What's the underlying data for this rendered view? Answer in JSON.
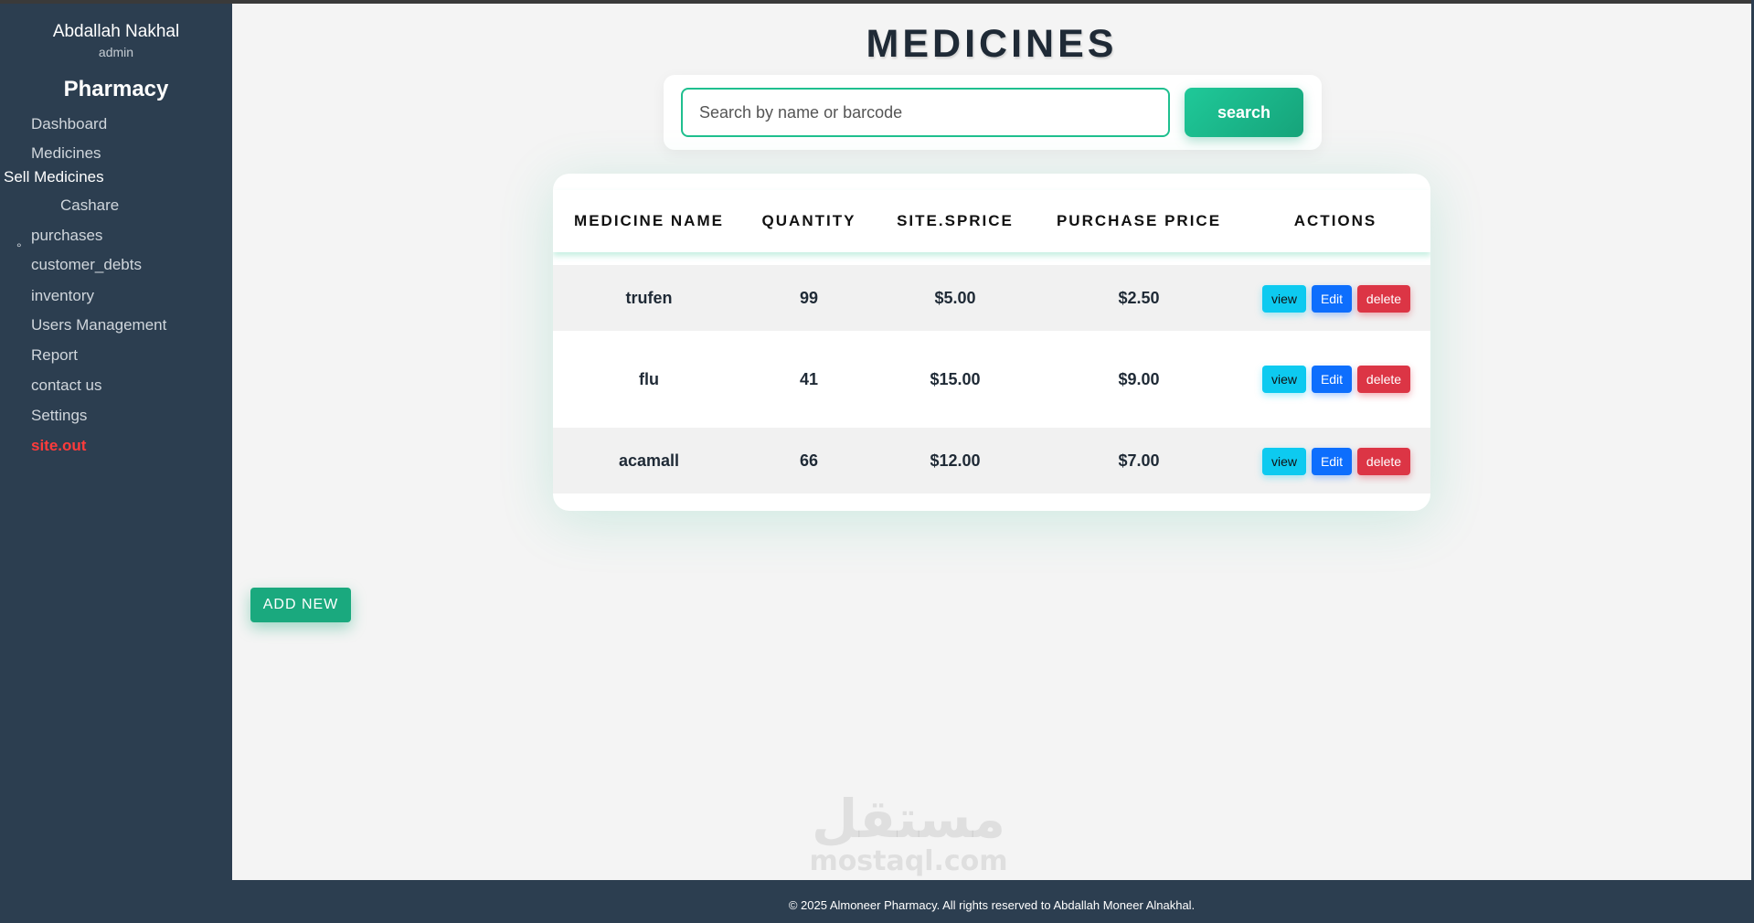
{
  "sidebar": {
    "user_name": "Abdallah Nakhal",
    "user_role": "admin",
    "brand": "Pharmacy",
    "items": [
      {
        "label": "Dashboard"
      },
      {
        "label": "Medicines"
      },
      {
        "label": "Sell Medicines"
      },
      {
        "label": "Cashare"
      },
      {
        "label": "purchases"
      },
      {
        "label": "customer_debts"
      },
      {
        "label": "inventory"
      },
      {
        "label": "Users Management"
      },
      {
        "label": "Report"
      },
      {
        "label": "contact us"
      },
      {
        "label": "Settings"
      },
      {
        "label": "site.out"
      }
    ],
    "bullet": "°"
  },
  "main": {
    "title": "MEDICINES",
    "search": {
      "placeholder": "Search by name or barcode",
      "button_label": "search"
    },
    "table": {
      "headers": [
        "MEDICINE NAME",
        "QUANTITY",
        "SITE.SPRICE",
        "PURCHASE PRICE",
        "ACTIONS"
      ],
      "rows": [
        {
          "name": "trufen",
          "quantity": "99",
          "sale_price": "$5.00",
          "purchase_price": "$2.50"
        },
        {
          "name": "flu",
          "quantity": "41",
          "sale_price": "$15.00",
          "purchase_price": "$9.00"
        },
        {
          "name": "acamall",
          "quantity": "66",
          "sale_price": "$12.00",
          "purchase_price": "$7.00"
        }
      ],
      "actions": {
        "view": "view",
        "edit": "Edit",
        "delete": "delete"
      }
    },
    "add_new_label": "ADD NEW"
  },
  "watermark": {
    "arabic": "مستقل",
    "latin": "mostaql.com"
  },
  "footer": {
    "text": "© 2025 Almoneer Pharmacy. All rights reserved to Abdallah Moneer Alnakhal."
  },
  "colors": {
    "sidebar_bg": "#2c3e50",
    "accent_green": "#1fbf8f",
    "view_btn": "#0dcaf0",
    "edit_btn": "#0d6efd",
    "delete_btn": "#dc3545",
    "logout_red": "#ff3b3b"
  }
}
